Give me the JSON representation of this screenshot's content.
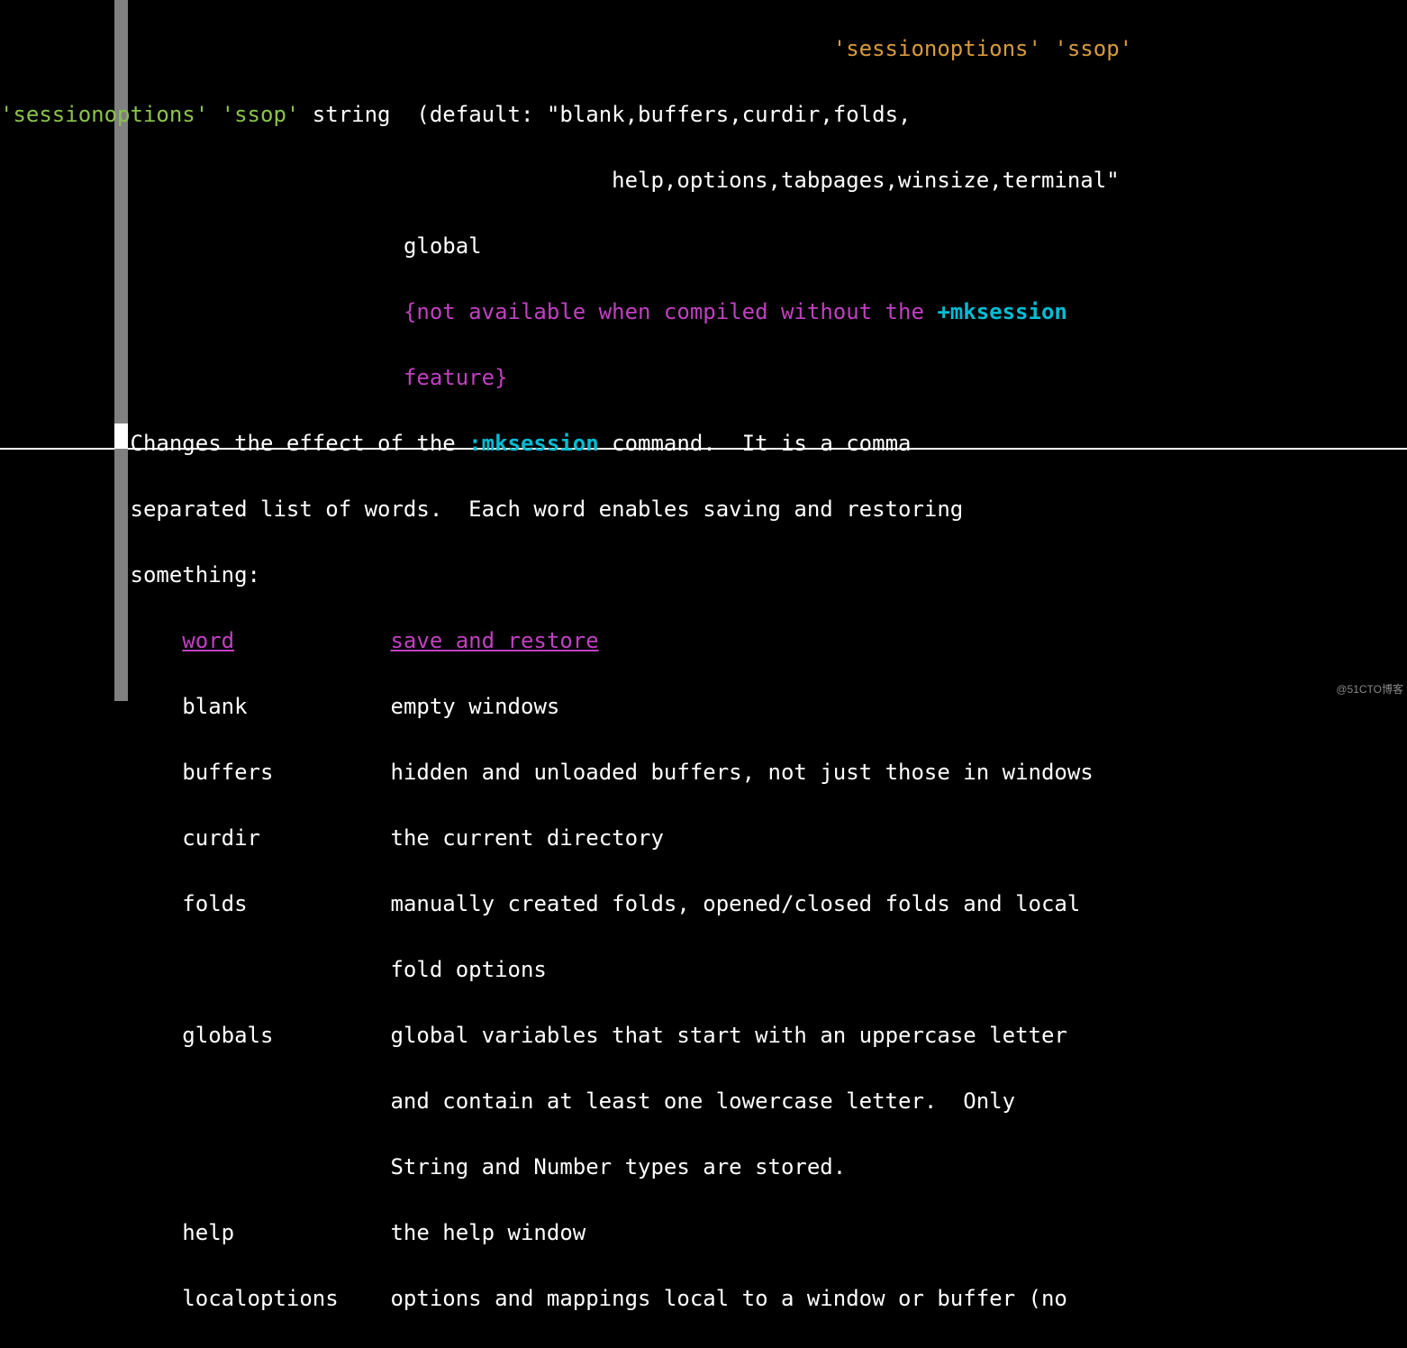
{
  "tags": {
    "tag1": "'sessionoptions'",
    "tag2": "'ssop'"
  },
  "option": {
    "long": "'sessionoptions'",
    "short": "'ssop'",
    "type": "string",
    "default_label": "(default: \"blank,buffers,curdir,folds,",
    "default_cont": "help,options,tabpages,winsize,terminal\"",
    "scope": "global",
    "feature_note_pre": "{not available when compiled without the ",
    "feature_link": "+mksession",
    "feature_note_post": "feature}"
  },
  "description": {
    "line1_pre": "Changes the effect of the ",
    "link": ":mksession",
    "line1_post": " command.  It is a comma",
    "line2": "separated list of words.  Each word enables saving and restoring",
    "line3": "something:"
  },
  "table": {
    "header_word": "word",
    "header_desc": "save and restore",
    "rows": [
      {
        "word": "blank",
        "desc": [
          "empty windows"
        ]
      },
      {
        "word": "buffers",
        "desc": [
          "hidden and unloaded buffers, not just those in windows"
        ]
      },
      {
        "word": "curdir",
        "desc": [
          "the current directory"
        ]
      },
      {
        "word": "folds",
        "desc": [
          "manually created folds, opened/closed folds and local",
          "fold options"
        ]
      },
      {
        "word": "globals",
        "desc": [
          "global variables that start with an uppercase letter",
          "and contain at least one lowercase letter.  Only",
          "String and Number types are stored."
        ]
      },
      {
        "word": "help",
        "desc": [
          "the help window"
        ]
      },
      {
        "word": "localoptions",
        "desc": [
          "options and mappings local to a window or buffer (no"
        ]
      }
    ]
  },
  "watermark": "@51CTO博客"
}
